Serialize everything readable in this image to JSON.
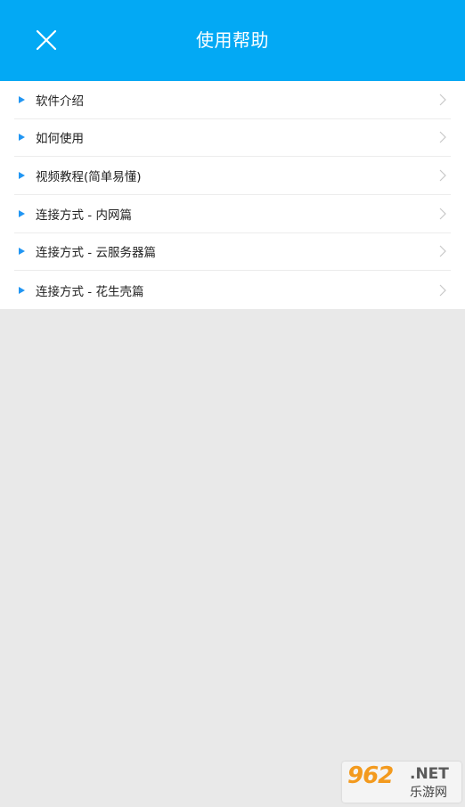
{
  "header": {
    "title": "使用帮助",
    "close_icon": "close-icon",
    "background_color": "#03a9f4"
  },
  "help_items": [
    {
      "label": "软件介绍",
      "icon": "triangle-bullet-icon",
      "trailing_icon": "chevron-right-icon"
    },
    {
      "label": "如何使用",
      "icon": "triangle-bullet-icon",
      "trailing_icon": "chevron-right-icon"
    },
    {
      "label": "视频教程(简单易懂)",
      "icon": "triangle-bullet-icon",
      "trailing_icon": "chevron-right-icon"
    },
    {
      "label": "连接方式 - 内网篇",
      "icon": "triangle-bullet-icon",
      "trailing_icon": "chevron-right-icon"
    },
    {
      "label": "连接方式 - 云服务器篇",
      "icon": "triangle-bullet-icon",
      "trailing_icon": "chevron-right-icon"
    },
    {
      "label": "连接方式 - 花生壳篇",
      "icon": "triangle-bullet-icon",
      "trailing_icon": "chevron-right-icon"
    }
  ],
  "watermark": {
    "number": "962",
    "suffix": ".NET",
    "site_name": "乐游网"
  }
}
